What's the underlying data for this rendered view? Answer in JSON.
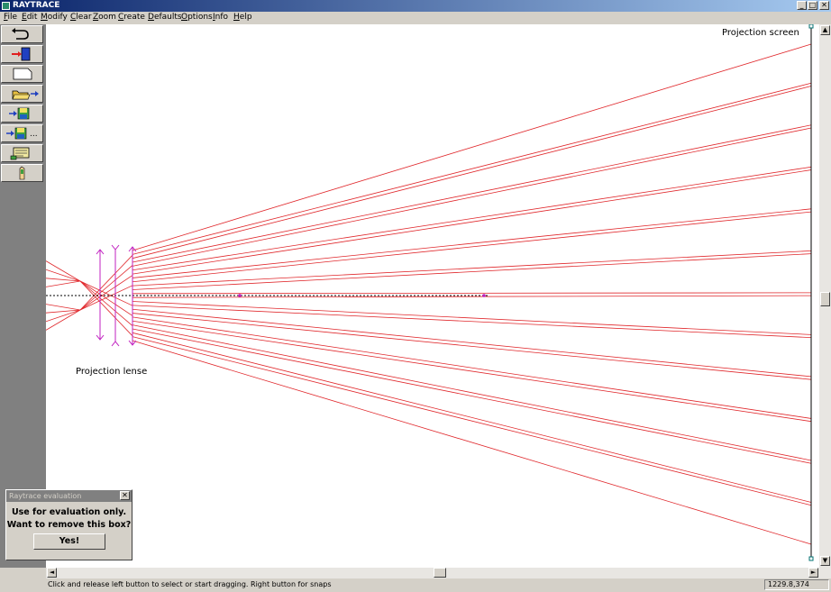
{
  "window": {
    "title": "RAYTRACE",
    "min_glyph": "_",
    "max_glyph": "□",
    "close_glyph": "✕"
  },
  "menu": [
    "File",
    "Edit",
    "Modify",
    "Clear",
    "Zoom",
    "Create",
    "Defaults",
    "Options",
    "Info",
    "Help"
  ],
  "toolbar": {
    "icons": [
      "undo-icon",
      "exit-door-icon",
      "new-file-icon",
      "open-folder-icon",
      "save-disk-icon",
      "save-as-disk-icon",
      "print-scroll-icon",
      "pointer-hand-icon"
    ],
    "save_as_suffix": "..."
  },
  "canvas": {
    "screen_label": "Projection screen",
    "lens_label": "Projection lense",
    "colors": {
      "ray": "#e0282c",
      "lens": "#c020c0",
      "axis": "#000000",
      "screen": "#000000"
    }
  },
  "scrollbars": {
    "up": "▲",
    "down": "▼",
    "left": "◄",
    "right": "►"
  },
  "status": {
    "message": "Click and release left button to select or start dragging. Right button for snaps",
    "coords": "1229.8,374"
  },
  "eval_dialog": {
    "title": "Raytrace evaluation",
    "close_glyph": "✕",
    "line1": "Use for evaluation only.",
    "line2": "Want to remove this box?",
    "button": "Yes!"
  }
}
